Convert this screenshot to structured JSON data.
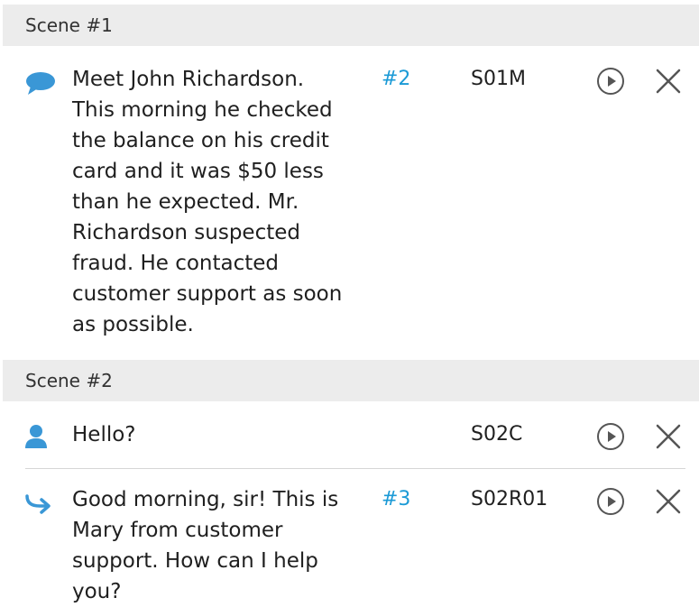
{
  "scenes": [
    {
      "title": "Scene #1",
      "items": [
        {
          "icon": "speech-bubble-icon",
          "text": "Meet John Richardson. This morning he checked the balance on his credit card and it was $50 less than he expected. Mr. Richardson suspected fraud. He contacted customer support as soon as possible.",
          "link": "#2",
          "code": "S01M"
        }
      ]
    },
    {
      "title": "Scene #2",
      "items": [
        {
          "icon": "person-icon",
          "text": "Hello?",
          "link": "",
          "code": "S02C"
        },
        {
          "icon": "reply-arrow-icon",
          "text": "Good morning, sir! This is Mary from customer support. How can I help you?",
          "link": "#3",
          "code": "S02R01"
        }
      ]
    }
  ],
  "colors": {
    "accent": "#1b9ad6",
    "header_bg": "#ececec",
    "text": "#1f1f1f",
    "icon_gray": "#555555"
  }
}
